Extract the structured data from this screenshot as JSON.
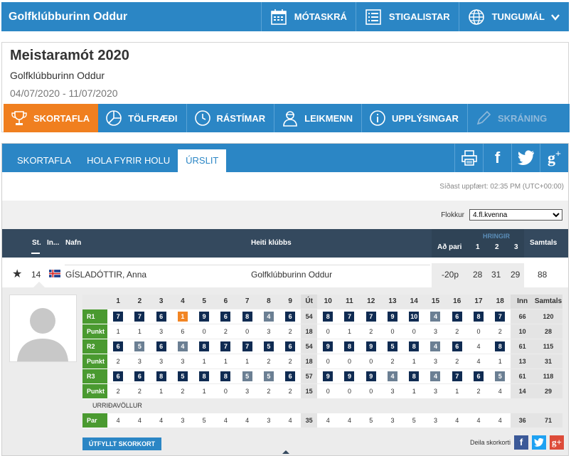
{
  "topbar": {
    "brand": "Golfklúbburinn Oddur",
    "items": [
      "MÓTASKRÁ",
      "STIGALISTAR",
      "TUNGUMÁL"
    ]
  },
  "tournament": {
    "title": "Meistaramót 2020",
    "club": "Golfklúbburinn Oddur",
    "dates": "04/07/2020 - 11/07/2020"
  },
  "maintabs": [
    "SKORTAFLA",
    "TÖLFRÆÐI",
    "RÁSTÍMAR",
    "LEIKMENN",
    "UPPLÝSINGAR",
    "SKRÁNING"
  ],
  "subtabs": [
    "SKORTAFLA",
    "HOLA FYRIR HOLU",
    "ÚRSLIT"
  ],
  "updated": "Síðast uppfært: 02:35 PM (UTC+00:00)",
  "filter": {
    "label": "Flokkur",
    "selected": "4.fl.kvenna"
  },
  "leaderboard": {
    "headers": {
      "pos": "St.",
      "init": "In...",
      "name": "Nafn",
      "club": "Heiti klúbbs",
      "hringir": "HRINGIR",
      "topar": "Að pari",
      "r1": "1",
      "r2": "2",
      "r3": "3",
      "total": "Samtals"
    },
    "row": {
      "pos": "14",
      "name": "GÍSLADÓTTIR, Anna",
      "club": "Golfklúbburinn Oddur",
      "topar": "-20p",
      "r1": "28",
      "r2": "31",
      "r3": "29",
      "total": "88"
    }
  },
  "scorecard": {
    "holes": [
      "1",
      "2",
      "3",
      "4",
      "5",
      "6",
      "7",
      "8",
      "9",
      "Út",
      "10",
      "11",
      "12",
      "13",
      "14",
      "15",
      "16",
      "17",
      "18",
      "Inn",
      "Samtals"
    ],
    "rounds": [
      {
        "label": "R1",
        "scores": [
          {
            "v": "7",
            "t": "p"
          },
          {
            "v": "7",
            "t": "p"
          },
          {
            "v": "6",
            "t": "p"
          },
          {
            "v": "1",
            "t": "o"
          },
          {
            "v": "9",
            "t": "p"
          },
          {
            "v": "6",
            "t": "p"
          },
          {
            "v": "8",
            "t": "p"
          },
          {
            "v": "4",
            "t": "g"
          },
          {
            "v": "6",
            "t": "p"
          },
          {
            "v": "54",
            "t": "sum"
          },
          {
            "v": "8",
            "t": "p"
          },
          {
            "v": "7",
            "t": "p"
          },
          {
            "v": "7",
            "t": "p"
          },
          {
            "v": "9",
            "t": "p"
          },
          {
            "v": "10",
            "t": "p"
          },
          {
            "v": "4",
            "t": "g"
          },
          {
            "v": "6",
            "t": "p"
          },
          {
            "v": "8",
            "t": "p"
          },
          {
            "v": "7",
            "t": "p"
          },
          {
            "v": "66",
            "t": "sum"
          },
          {
            "v": "120",
            "t": "sum"
          }
        ],
        "points": [
          "1",
          "1",
          "3",
          "6",
          "0",
          "2",
          "0",
          "3",
          "2",
          "18",
          "0",
          "1",
          "2",
          "0",
          "0",
          "3",
          "2",
          "0",
          "2",
          "10",
          "28"
        ]
      },
      {
        "label": "R2",
        "scores": [
          {
            "v": "6",
            "t": "p"
          },
          {
            "v": "5",
            "t": "g"
          },
          {
            "v": "6",
            "t": "p"
          },
          {
            "v": "4",
            "t": "g"
          },
          {
            "v": "8",
            "t": "p"
          },
          {
            "v": "7",
            "t": "p"
          },
          {
            "v": "7",
            "t": "p"
          },
          {
            "v": "5",
            "t": "p"
          },
          {
            "v": "6",
            "t": "p"
          },
          {
            "v": "54",
            "t": "sum"
          },
          {
            "v": "9",
            "t": "p"
          },
          {
            "v": "8",
            "t": "p"
          },
          {
            "v": "9",
            "t": "p"
          },
          {
            "v": "5",
            "t": "p"
          },
          {
            "v": "8",
            "t": "p"
          },
          {
            "v": "4",
            "t": "g"
          },
          {
            "v": "6",
            "t": "p"
          },
          {
            "v": "4",
            "t": "e"
          },
          {
            "v": "8",
            "t": "p"
          },
          {
            "v": "61",
            "t": "sum"
          },
          {
            "v": "115",
            "t": "sum"
          }
        ],
        "points": [
          "2",
          "3",
          "3",
          "3",
          "1",
          "1",
          "1",
          "2",
          "2",
          "18",
          "0",
          "0",
          "0",
          "2",
          "1",
          "3",
          "2",
          "4",
          "1",
          "13",
          "31"
        ]
      },
      {
        "label": "R3",
        "scores": [
          {
            "v": "6",
            "t": "p"
          },
          {
            "v": "6",
            "t": "p"
          },
          {
            "v": "8",
            "t": "p"
          },
          {
            "v": "5",
            "t": "p"
          },
          {
            "v": "8",
            "t": "p"
          },
          {
            "v": "8",
            "t": "p"
          },
          {
            "v": "5",
            "t": "g"
          },
          {
            "v": "5",
            "t": "g"
          },
          {
            "v": "6",
            "t": "p"
          },
          {
            "v": "57",
            "t": "sum"
          },
          {
            "v": "9",
            "t": "p"
          },
          {
            "v": "9",
            "t": "p"
          },
          {
            "v": "9",
            "t": "p"
          },
          {
            "v": "4",
            "t": "g"
          },
          {
            "v": "8",
            "t": "p"
          },
          {
            "v": "4",
            "t": "g"
          },
          {
            "v": "7",
            "t": "p"
          },
          {
            "v": "6",
            "t": "p"
          },
          {
            "v": "5",
            "t": "g"
          },
          {
            "v": "61",
            "t": "sum"
          },
          {
            "v": "118",
            "t": "sum"
          }
        ],
        "points": [
          "2",
          "2",
          "1",
          "2",
          "1",
          "0",
          "3",
          "2",
          "2",
          "15",
          "0",
          "0",
          "0",
          "3",
          "1",
          "3",
          "1",
          "2",
          "4",
          "14",
          "29"
        ]
      }
    ],
    "points_label": "Punkt",
    "course": "URRIÐAVÖLLUR",
    "par_label": "Par",
    "par": [
      "4",
      "4",
      "4",
      "3",
      "5",
      "4",
      "4",
      "3",
      "4",
      "35",
      "4",
      "4",
      "5",
      "3",
      "5",
      "3",
      "4",
      "4",
      "4",
      "36",
      "71"
    ]
  },
  "buttons": {
    "scorecard": "ÚTFYLLT SKORKORT",
    "share": "Deila skorkorti"
  },
  "colors": {
    "blue": "#2b86c5",
    "orange": "#f07f1f",
    "dark": "#34495e",
    "green": "#4a9a30",
    "navy": "#0f2b52"
  }
}
